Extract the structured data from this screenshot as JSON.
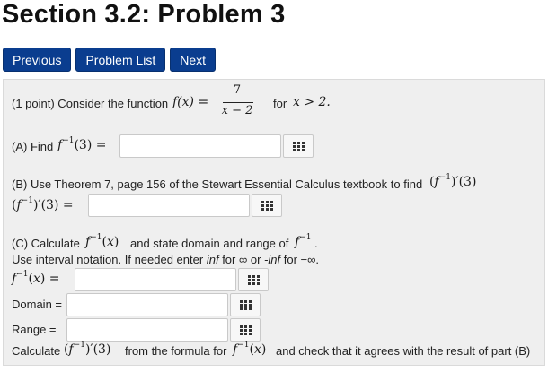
{
  "header": {
    "title": "Section 3.2: Problem 3"
  },
  "nav": {
    "previous": "Previous",
    "problem_list": "Problem List",
    "next": "Next"
  },
  "problem": {
    "intro": "(1 point) Consider the function",
    "f_of_x": "f(x) =",
    "numerator": "7",
    "denominator": "x − 2",
    "for_text": "for",
    "domain_condition": "x > 2.",
    "part_a_label": "(A) Find",
    "part_b_text": "(B) Use Theorem 7, page 156 of the Stewart Essential Calculus textbook to find",
    "part_c_text1": "(C) Calculate",
    "part_c_text2": "and state domain and range of",
    "part_c_text3": ".",
    "interval_text1": "Use interval notation. If needed enter",
    "interval_inf": "inf",
    "interval_text2": "for ∞ or",
    "interval_neginf": "-inf",
    "interval_text3": "for −∞.",
    "domain_label": "Domain =",
    "range_label": "Range =",
    "calc_text1": "Calculate",
    "calc_text2": "from the formula for",
    "calc_text3": "and check that it agrees with the result of part (B)"
  },
  "inputs": {
    "part_a": "",
    "part_b": "",
    "part_c_formula": "",
    "domain": "",
    "range": ""
  },
  "icons": {
    "keyboard": "keypad-icon"
  }
}
